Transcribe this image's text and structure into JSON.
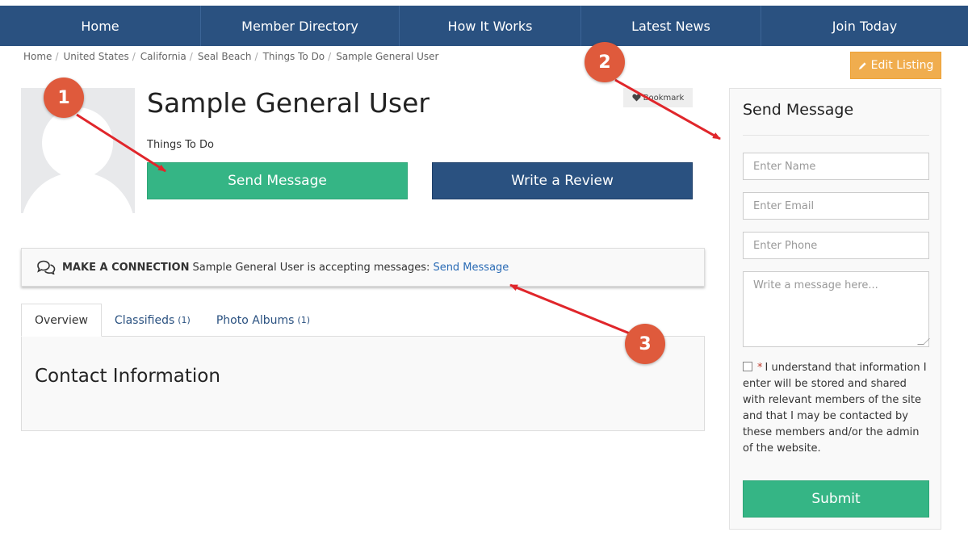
{
  "nav": {
    "items": [
      "Home",
      "Member Directory",
      "How It Works",
      "Latest News",
      "Join Today"
    ]
  },
  "breadcrumb": [
    "Home",
    "United States",
    "California",
    "Seal Beach",
    "Things To Do",
    "Sample General User"
  ],
  "breadcrumb_separator": "/",
  "edit_listing": {
    "label": "Edit Listing",
    "icon": "pencil-icon"
  },
  "profile": {
    "name": "Sample General User",
    "category": "Things To Do",
    "bookmark_label": "Bookmark",
    "send_message_label": "Send Message",
    "write_review_label": "Write a Review"
  },
  "connection": {
    "icon": "chat-bubbles-icon",
    "heading": "MAKE A CONNECTION",
    "text": "Sample General User is accepting messages:",
    "link": "Send Message"
  },
  "tabs": [
    {
      "label": "Overview",
      "count": ""
    },
    {
      "label": "Classifieds",
      "count": "(1)"
    },
    {
      "label": "Photo Albums",
      "count": "(1)"
    }
  ],
  "overview": {
    "section_title": "Contact Information"
  },
  "sidebar": {
    "title": "Send Message",
    "name_placeholder": "Enter Name",
    "email_placeholder": "Enter Email",
    "phone_placeholder": "Enter Phone",
    "message_placeholder": "Write a message here...",
    "consent_asterisk": "*",
    "consent_text": "I understand that information I enter will be stored and shared with relevant members of the site and that I may be contacted by these members and/or the admin of the website.",
    "submit_label": "Submit"
  },
  "annotations": [
    "1",
    "2",
    "3"
  ],
  "colors": {
    "nav": "#2a5180",
    "green": "#35b585",
    "orange": "#f0ad4e",
    "annotation": "#df5a3c",
    "arrow": "#e0262b"
  }
}
